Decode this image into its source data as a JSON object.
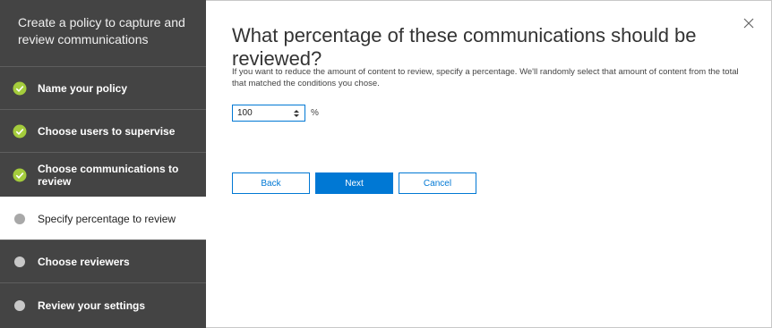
{
  "sidebar": {
    "title": "Create a policy to capture and review communications",
    "steps": [
      {
        "label": "Name your policy",
        "state": "complete",
        "icon": "check-circle-icon"
      },
      {
        "label": "Choose users to supervise",
        "state": "complete",
        "icon": "check-circle-icon"
      },
      {
        "label": "Choose communications to review",
        "state": "complete",
        "icon": "check-circle-icon"
      },
      {
        "label": "Specify percentage to review",
        "state": "current",
        "icon": "dot-icon"
      },
      {
        "label": "Choose reviewers",
        "state": "pending",
        "icon": "dot-icon"
      },
      {
        "label": "Review your settings",
        "state": "pending",
        "icon": "dot-icon"
      }
    ]
  },
  "main": {
    "heading": "What percentage of these communications should be reviewed?",
    "description": "If you want to reduce the amount of content to review, specify a percentage. We'll randomly select that amount of content from the total that matched the conditions you chose.",
    "percentage": {
      "value": "100",
      "unit": "%"
    }
  },
  "buttons": {
    "back": "Back",
    "next": "Next",
    "cancel": "Cancel"
  },
  "colors": {
    "sidebar_bg": "#444444",
    "accent": "#0078d4",
    "check": "#a4cc3c"
  }
}
